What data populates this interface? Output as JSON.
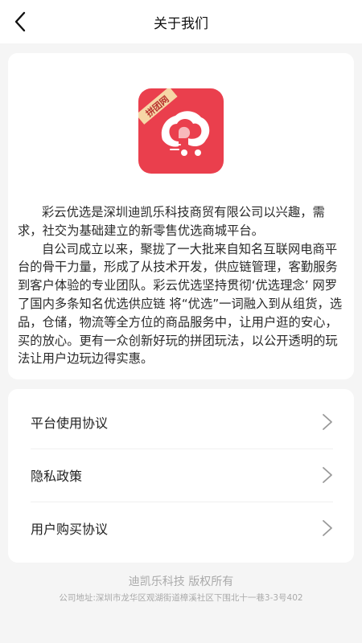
{
  "header": {
    "title": "关于我们",
    "back_icon": "chevron-left-icon"
  },
  "about": {
    "logo_icon": "caiyun-app-logo",
    "logo_badge": "拼团网",
    "logo_color": "#ea3f4d",
    "paragraph_1": "彩云优选是深圳迪凯乐科技商贸有限公司以兴趣，需求，社交为基础建立的新零售优选商城平台。",
    "paragraph_2": "自公司成立以来，聚拢了一大批来自知名互联网电商平台的骨干力量，形成了从技术开发，供应链管理，客勤服务到客户体验的专业团队。彩云优选坚持贯彻‘优选理念’ 网罗了国内多条知名优选供应链 将“优选”一词融入到从组货，选品，仓储，物流等全方位的商品服务中，让用户逛的安心，买的放心。更有一众创新好玩的拼团玩法，以公开透明的玩法让用户边玩边得实惠。"
  },
  "menu": {
    "items": [
      {
        "label": "平台使用协议",
        "icon": "chevron-right-icon"
      },
      {
        "label": "隐私政策",
        "icon": "chevron-right-icon"
      },
      {
        "label": "用户购买协议",
        "icon": "chevron-right-icon"
      }
    ]
  },
  "footer": {
    "copyright": "迪凯乐科技 版权所有",
    "address": "公司地址:深圳市龙华区观湖街道樟溪社区下围北十一巷3-3号402"
  }
}
